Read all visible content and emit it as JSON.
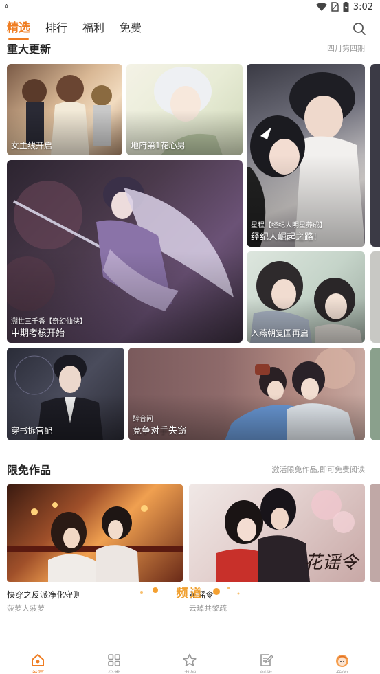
{
  "status_bar": {
    "app_badge": "A",
    "time": "3:02"
  },
  "top_nav": {
    "tabs": [
      {
        "label": "精选",
        "active": true
      },
      {
        "label": "排行",
        "active": false
      },
      {
        "label": "福利",
        "active": false
      },
      {
        "label": "免费",
        "active": false
      }
    ],
    "search_icon": "search-icon"
  },
  "updates_section": {
    "title": "重大更新",
    "subtitle": "四月第四期",
    "cards": [
      {
        "subtitle": "",
        "title": "女主线开启"
      },
      {
        "subtitle": "",
        "title": "地府第1花心男"
      },
      {
        "subtitle": "星程【经纪人明星养成】",
        "title": "经纪人崛起之路!"
      },
      {
        "subtitle": "溯世三千香【奇幻仙侠】",
        "title": "中期考核开始"
      },
      {
        "subtitle": "",
        "title": "入燕朝复国再启"
      },
      {
        "subtitle": "",
        "title": "穿书拆官配"
      },
      {
        "subtitle": "醉音间",
        "title": "竞争对手失窃"
      }
    ]
  },
  "free_section": {
    "title": "限免作品",
    "subtitle": "激活限免作品,即可免费阅读",
    "items": [
      {
        "name": "快穿之反派净化守则",
        "author": "菠萝大菠萝"
      },
      {
        "name": "花谣令",
        "author": "云琸共黎疏"
      }
    ],
    "cover_art_text": "花谣令"
  },
  "channel": {
    "label": "频道"
  },
  "bottom_bar": {
    "items": [
      {
        "label": "首页",
        "icon": "home-icon",
        "active": true
      },
      {
        "label": "分类",
        "icon": "grid-icon",
        "active": false
      },
      {
        "label": "书架",
        "icon": "star-icon",
        "active": false
      },
      {
        "label": "创作",
        "icon": "edit-icon",
        "active": false
      },
      {
        "label": "我的",
        "icon": "avatar-icon",
        "active": false
      }
    ]
  },
  "colors": {
    "accent": "#ef7d22",
    "channel": "#f0a030"
  }
}
